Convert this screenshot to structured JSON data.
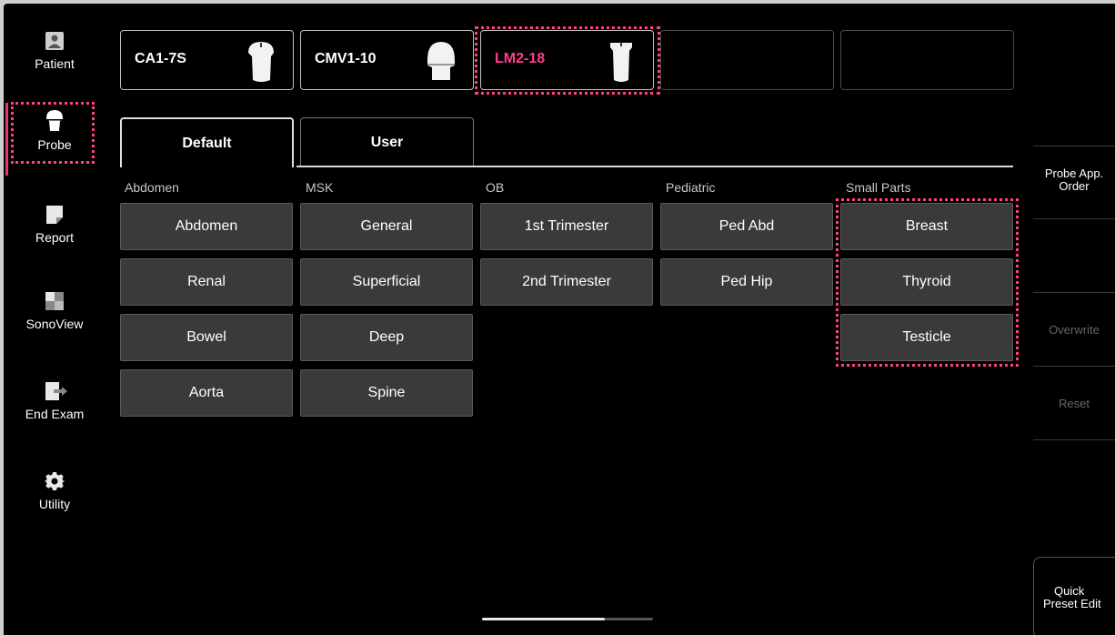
{
  "sidebar": {
    "items": [
      {
        "label": "Patient",
        "icon": "patient-icon"
      },
      {
        "label": "Probe",
        "icon": "probe-icon"
      },
      {
        "label": "Report",
        "icon": "report-icon"
      },
      {
        "label": "SonoView",
        "icon": "sonoview-icon"
      },
      {
        "label": "End Exam",
        "icon": "end-exam-icon"
      },
      {
        "label": "Utility",
        "icon": "gear-icon"
      }
    ]
  },
  "probes": [
    {
      "name": "CA1-7S"
    },
    {
      "name": "CMV1-10"
    },
    {
      "name": "LM2-18"
    },
    {
      "name": ""
    },
    {
      "name": ""
    }
  ],
  "tabs": [
    {
      "label": "Default"
    },
    {
      "label": "User"
    }
  ],
  "categories": [
    {
      "label": "Abdomen",
      "presets": [
        "Abdomen",
        "Renal",
        "Bowel",
        "Aorta"
      ]
    },
    {
      "label": "MSK",
      "presets": [
        "General",
        "Superficial",
        "Deep",
        "Spine"
      ]
    },
    {
      "label": "OB",
      "presets": [
        "1st Trimester",
        "2nd Trimester"
      ]
    },
    {
      "label": "Pediatric",
      "presets": [
        "Ped Abd",
        "Ped Hip"
      ]
    },
    {
      "label": "Small Parts",
      "presets": [
        "Breast",
        "Thyroid",
        "Testicle"
      ]
    }
  ],
  "right_panel": {
    "probe_app_order": "Probe App. Order",
    "overwrite": "Overwrite",
    "reset": "Reset",
    "quick_preset_edit_1": "Quick",
    "quick_preset_edit_2": "Preset Edit"
  },
  "colors": {
    "accent": "#ff3d8b",
    "highlight_dots": "#ff4477"
  }
}
